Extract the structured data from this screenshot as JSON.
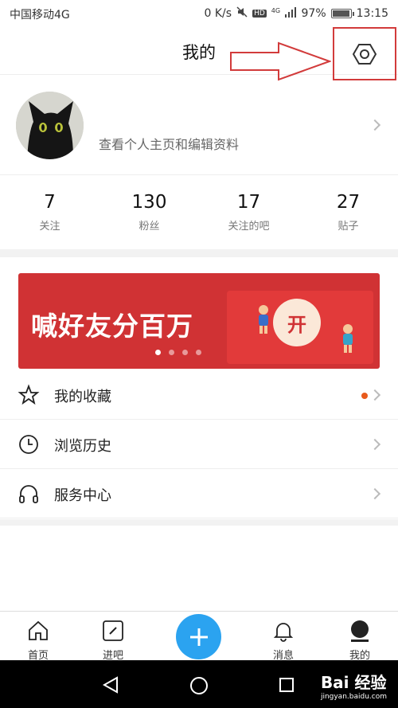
{
  "status_bar": {
    "carrier": "中国移动4G",
    "speed": "0 K/s",
    "network_badge": "HD",
    "signal_label": "4G",
    "battery": "97%",
    "battery_level": 0.97,
    "time": "13:15"
  },
  "header": {
    "title": "我的",
    "settings_icon": "hexagon-settings-icon"
  },
  "annotation": {
    "color": "#d23b3b"
  },
  "profile": {
    "hint": "查看个人主页和编辑资料"
  },
  "stats": [
    {
      "value": "7",
      "label": "关注"
    },
    {
      "value": "130",
      "label": "粉丝"
    },
    {
      "value": "17",
      "label": "关注的吧"
    },
    {
      "value": "27",
      "label": "贴子"
    }
  ],
  "banner": {
    "text": "喊好友分百万",
    "button": "开",
    "page_count": 4,
    "active_page": 1
  },
  "menu": [
    {
      "label": "我的收藏",
      "icon": "star-icon",
      "badge_dot": true
    },
    {
      "label": "浏览历史",
      "icon": "clock-icon",
      "badge_dot": false
    },
    {
      "label": "服务中心",
      "icon": "headphones-icon",
      "badge_dot": false
    }
  ],
  "tabs": [
    {
      "label": "首页",
      "icon": "home-icon"
    },
    {
      "label": "进吧",
      "icon": "enter-bar-icon"
    },
    {
      "label": "",
      "icon": "plus-icon"
    },
    {
      "label": "消息",
      "icon": "bell-icon"
    },
    {
      "label": "我的",
      "icon": "profile-icon"
    }
  ],
  "watermark": {
    "logo": "Bai 经验",
    "url": "jingyan.baidu.com"
  },
  "colors": {
    "accent": "#2ba3f0",
    "banner_red": "#d03234",
    "dot_orange": "#e85a1c"
  }
}
